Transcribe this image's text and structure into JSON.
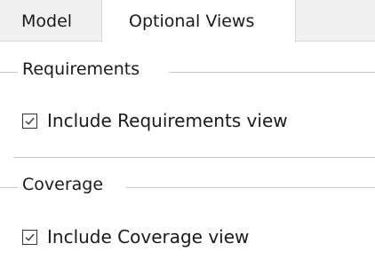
{
  "tabs": {
    "model_label": "Model",
    "optional_views_label": "Optional Views",
    "active": "Optional Views"
  },
  "requirements": {
    "group_title": "Requirements",
    "checkbox_label": "Include Requirements view",
    "checked": true
  },
  "coverage": {
    "group_title": "Coverage",
    "checkbox_label": "Include Coverage view",
    "checked": true
  },
  "colors": {
    "tab_strip_bg": "#f0f0f0",
    "panel_bg": "#ffffff",
    "line": "#c8c8c8"
  }
}
